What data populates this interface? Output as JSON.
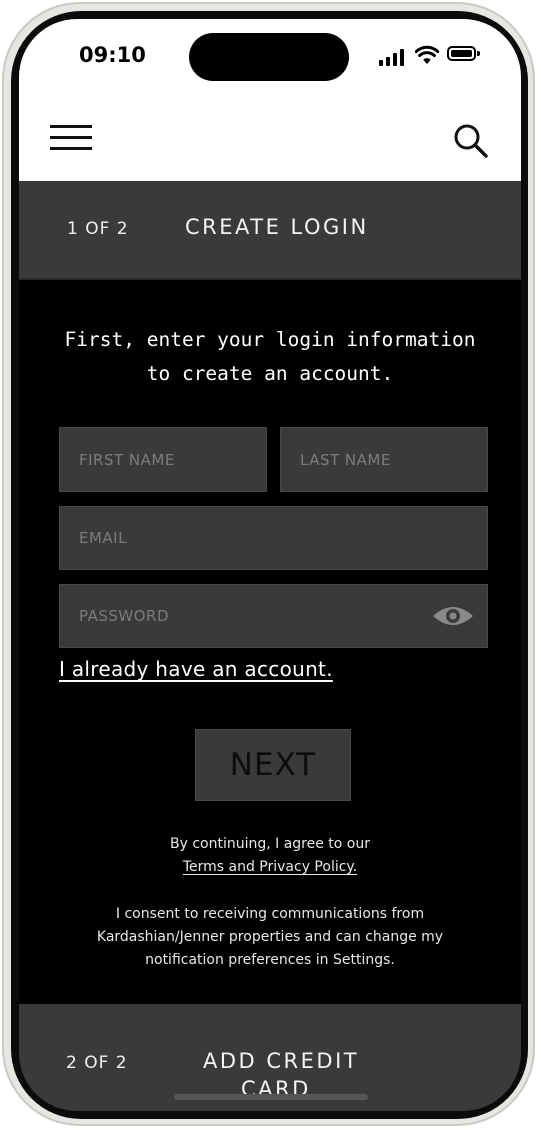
{
  "status_bar": {
    "time": "09:10"
  },
  "step_current": {
    "number": "1 OF 2",
    "title": "CREATE LOGIN"
  },
  "intro": "First, enter your login information to create an account.",
  "form": {
    "first_name_placeholder": "FIRST NAME",
    "last_name_placeholder": "LAST NAME",
    "email_placeholder": "EMAIL",
    "password_placeholder": "PASSWORD",
    "password_toggle_icon": "eye-icon"
  },
  "existing_account_link": "I already have an account.",
  "next_label": "NEXT",
  "legal": {
    "continuing_text": "By continuing, I agree to our",
    "terms_link": "Terms and Privacy Policy.",
    "consent_text": "I consent to receiving communications from Kardashian/Jenner properties and can change my notification preferences in Settings."
  },
  "step_next": {
    "number": "2 OF 2",
    "title_line1": "ADD CREDIT",
    "title_line2": "CARD"
  },
  "icons": {
    "menu": "hamburger-menu-icon",
    "search": "search-icon"
  },
  "colors": {
    "panel": "#3a3a3a",
    "background": "#000000",
    "text": "#ffffff"
  }
}
